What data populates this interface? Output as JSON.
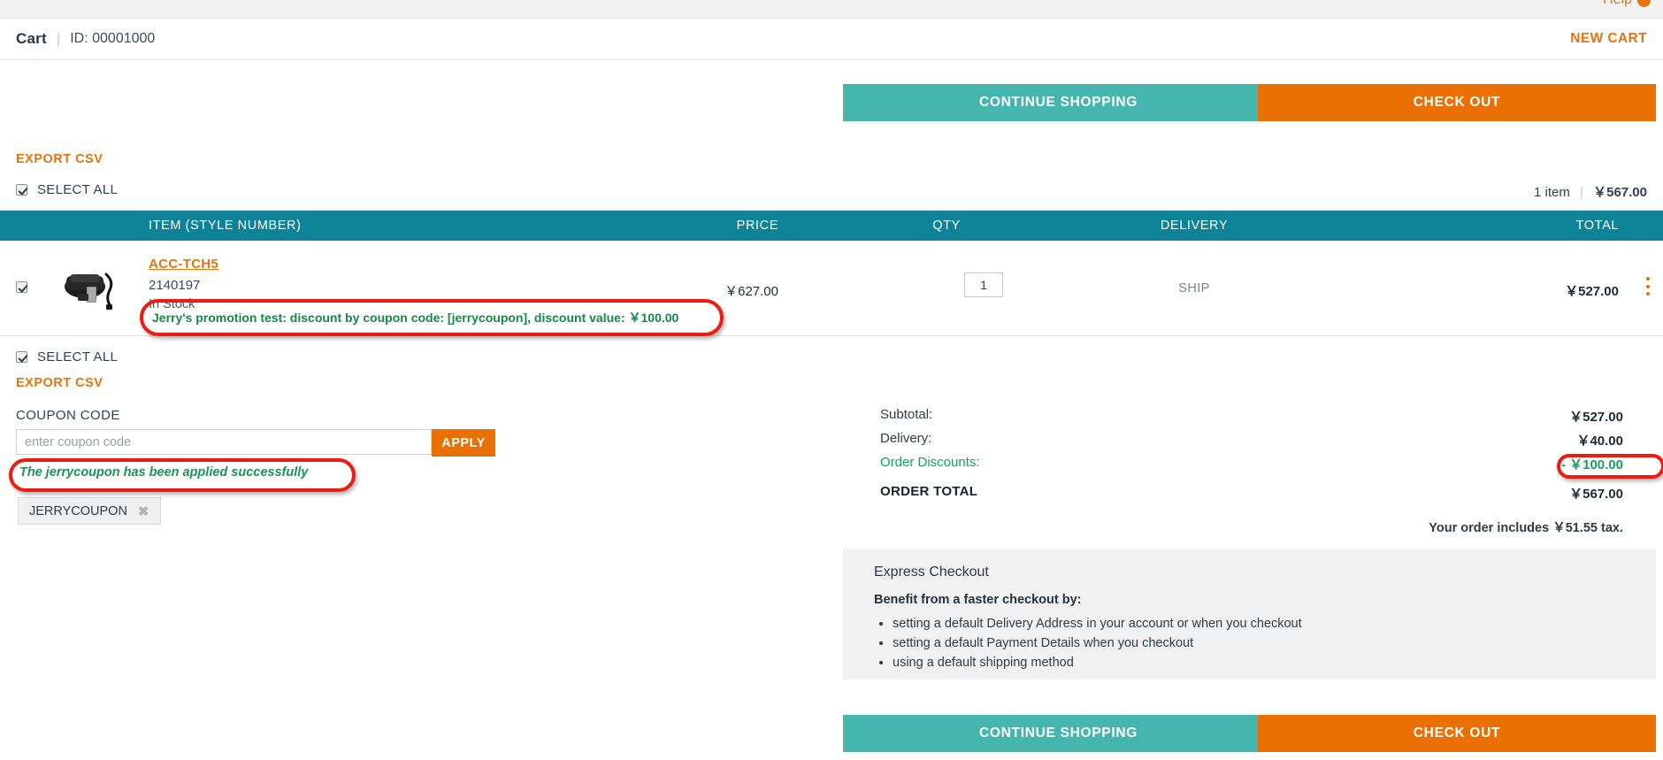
{
  "top": {
    "help_label": "Help",
    "help_icon": "help-circle-icon"
  },
  "header": {
    "cart_label": "Cart",
    "separator": "|",
    "cart_id": "ID: 00001000",
    "new_cart_label": "NEW CART"
  },
  "actions": {
    "continue_label": "CONTINUE SHOPPING",
    "checkout_label": "CHECK OUT",
    "continue_color": "#45b6ae",
    "checkout_color": "#ea7004"
  },
  "toolbar": {
    "export_csv_label": "EXPORT CSV",
    "select_all_label": "SELECT ALL",
    "item_count": "1 item",
    "count_separator": "|",
    "cart_total": "￥567.00"
  },
  "table": {
    "header_color": "#0e8296",
    "columns": {
      "item": "ITEM (STYLE NUMBER)",
      "price": "PRICE",
      "qty": "QTY",
      "delivery": "DELIVERY",
      "total": "TOTAL"
    },
    "row": {
      "sku": "ACC-TCH5",
      "style_number": "2140197",
      "stock_status": "In Stock",
      "promotion": "Jerry's promotion test: discount by coupon code: [jerrycoupon], discount value: ￥100.00",
      "price": "￥627.00",
      "qty": "1",
      "delivery": "SHIP",
      "total": "￥527.00",
      "menu_icon": "kebab-menu-icon",
      "thumbnail_alt": "black accessory case with battery and cable"
    }
  },
  "coupon": {
    "label": "COUPON CODE",
    "placeholder": "enter coupon code",
    "value": "",
    "apply_label": "APPLY",
    "success_message": "The jerrycoupon has been applied successfully",
    "applied_code": "JERRYCOUPON",
    "remove_icon": "✖",
    "success_color": "#1a9457"
  },
  "summary": {
    "subtotal_label": "Subtotal:",
    "subtotal_value": "￥527.00",
    "delivery_label": "Delivery:",
    "delivery_value": "￥40.00",
    "discount_label": "Order Discounts:",
    "discount_value": "- ￥100.00",
    "discount_color": "#15a05e",
    "order_total_label": "ORDER TOTAL",
    "order_total_value": "￥567.00",
    "tax_note": "Your order includes ￥51.55 tax."
  },
  "express": {
    "title": "Express Checkout",
    "subtitle": "Benefit from a faster checkout by:",
    "benefits": [
      "setting a default Delivery Address in your account or when you checkout",
      "setting a default Payment Details when you checkout",
      "using a default shipping method"
    ]
  },
  "annotations": {
    "color": "#ee1b11"
  }
}
